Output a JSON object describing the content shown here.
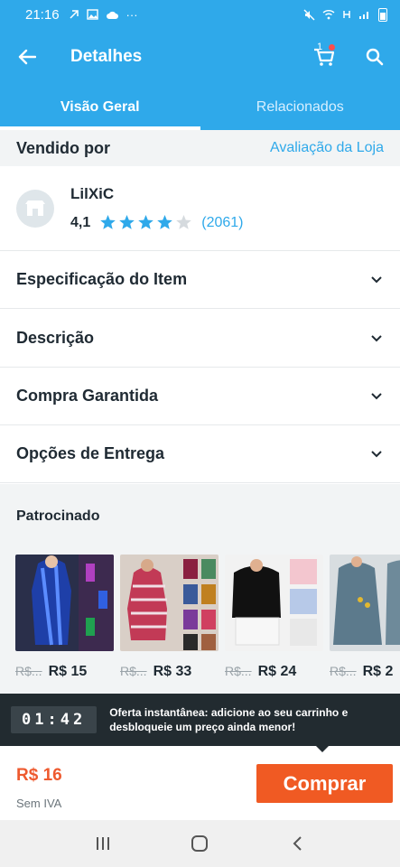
{
  "status_bar": {
    "time": "21:16",
    "more": "···"
  },
  "app_bar": {
    "title": "Detalhes",
    "cart_count": "1",
    "icons": [
      "back-arrow-icon",
      "cart-icon",
      "search-icon"
    ]
  },
  "tabs": [
    {
      "label": "Visão Geral",
      "active": true
    },
    {
      "label": "Relacionados",
      "active": false
    }
  ],
  "seller": {
    "sold_by_label": "Vendido por",
    "store_rating_link": "Avaliação da Loja",
    "name": "LilXiC",
    "rating": "4,1",
    "stars_filled": 4,
    "stars_total": 5,
    "reviews": "(2061)"
  },
  "accordion": [
    {
      "label": "Especificação do Item"
    },
    {
      "label": "Descrição"
    },
    {
      "label": "Compra Garantida"
    },
    {
      "label": "Opções de Entrega"
    }
  ],
  "sponsored": {
    "title": "Patrocinado",
    "products": [
      {
        "old_price": "R$...",
        "price": "R$ 15"
      },
      {
        "old_price": "R$...",
        "price": "R$ 33"
      },
      {
        "old_price": "R$...",
        "price": "R$ 24"
      },
      {
        "old_price": "R$...",
        "price": "R$ 2"
      }
    ]
  },
  "flash_offer": {
    "timer": "01:42",
    "message_line1": "Oferta instantânea: adicione ao seu carrinho e",
    "message_line2": "desbloqueie um preço ainda menor!"
  },
  "purchase": {
    "price": "R$ 16",
    "tax_note": "Sem IVA",
    "buy_label": "Comprar"
  },
  "colors": {
    "primary": "#2fa9ea",
    "buy": "#f05a23",
    "price": "#ee5a2f",
    "star": "#2fa9ea"
  }
}
